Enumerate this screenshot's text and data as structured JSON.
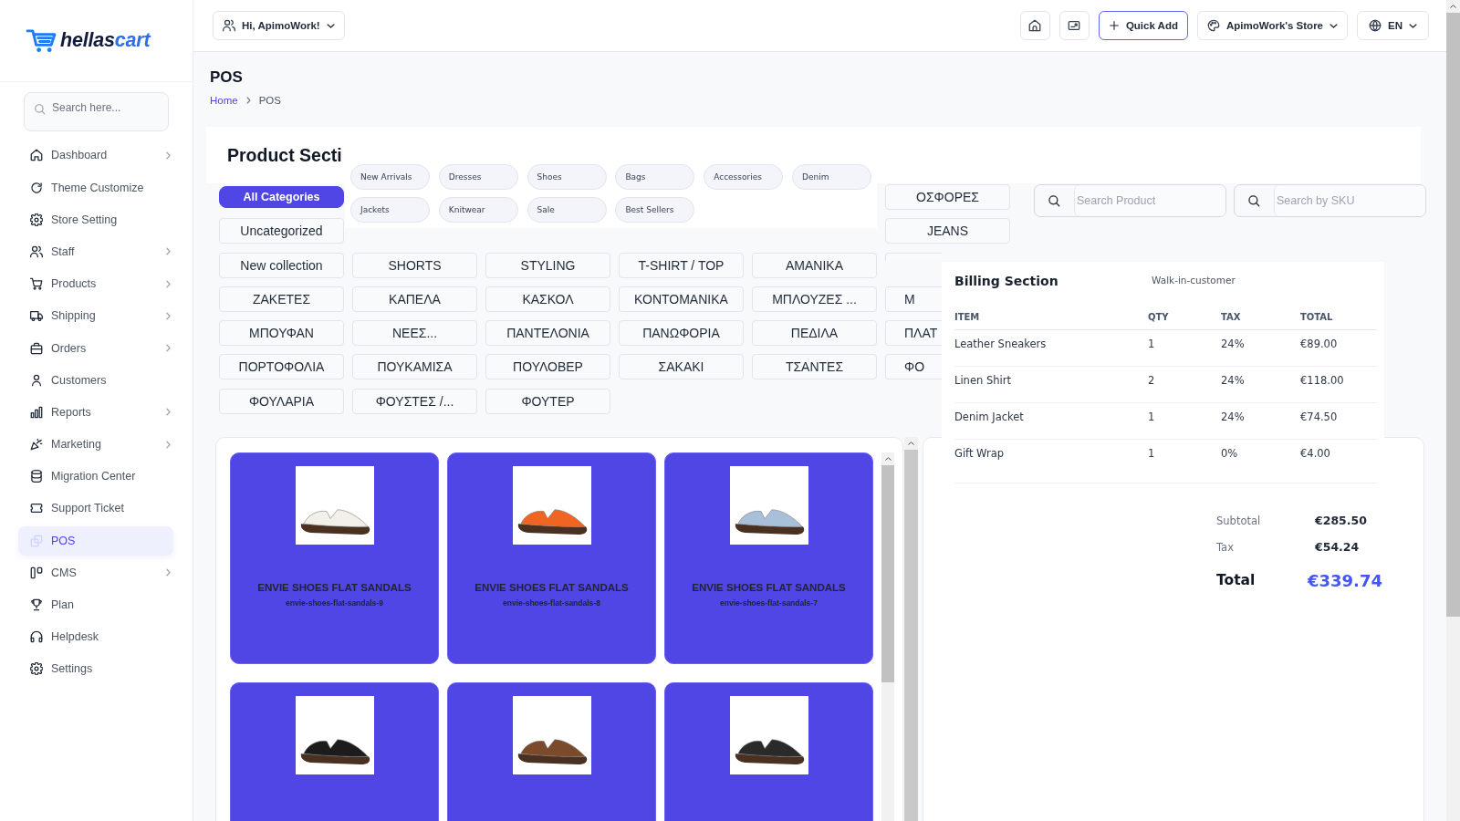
{
  "sidebar": {
    "logo": {
      "brand": "hellas",
      "brand_accent": "cart"
    },
    "search": {
      "placeholder": "Search here..."
    },
    "items": [
      {
        "label": "Dashboard",
        "submenu": true,
        "selected": false
      },
      {
        "label": "Theme Customize",
        "submenu": false,
        "selected": false
      },
      {
        "label": "Store Setting",
        "submenu": false,
        "selected": false
      },
      {
        "label": "Staff",
        "submenu": true,
        "selected": false
      },
      {
        "label": "Products",
        "submenu": true,
        "selected": false
      },
      {
        "label": "Shipping",
        "submenu": true,
        "selected": false
      },
      {
        "label": "Orders",
        "submenu": true,
        "selected": false
      },
      {
        "label": "Customers",
        "submenu": false,
        "selected": false
      },
      {
        "label": "Reports",
        "submenu": true,
        "selected": false
      },
      {
        "label": "Marketing",
        "submenu": true,
        "selected": false
      },
      {
        "label": "Migration Center",
        "submenu": false,
        "selected": false
      },
      {
        "label": "Support Ticket",
        "submenu": false,
        "selected": false
      },
      {
        "label": "POS",
        "submenu": false,
        "selected": true
      },
      {
        "label": "CMS",
        "submenu": true,
        "selected": false
      },
      {
        "label": "Plan",
        "submenu": false,
        "selected": false
      },
      {
        "label": "Helpdesk",
        "submenu": false,
        "selected": false
      },
      {
        "label": "Settings",
        "submenu": false,
        "selected": false
      }
    ]
  },
  "topbar": {
    "greeting": "Hi, ApimoWork!",
    "quick_add": "Quick Add",
    "store": "ApimoWork's Store",
    "language": "EN"
  },
  "page": {
    "title": "POS",
    "breadcrumb": [
      {
        "label": "Home",
        "kind": "link"
      },
      {
        "label": "POS",
        "kind": "current"
      }
    ]
  },
  "product_section": {
    "title": "Product Secti",
    "chips": [
      {
        "label": "New Arrivals",
        "selected": false
      },
      {
        "label": "Dresses",
        "selected": false
      },
      {
        "label": "Shoes",
        "selected": false
      },
      {
        "label": "Bags",
        "selected": false
      },
      {
        "label": "Accessories",
        "selected": false
      },
      {
        "label": "Denim",
        "selected": false
      },
      {
        "label": "Jackets",
        "selected": false
      },
      {
        "label": "Knitwear",
        "selected": false
      },
      {
        "label": "Sale",
        "selected": false
      },
      {
        "label": "Best Sellers",
        "selected": false
      }
    ],
    "categories": [
      {
        "label": "All Categories",
        "selected": true
      },
      {
        "label": "ΟΣΦΟΡΕΣ",
        "selected": false
      },
      {
        "label": "Uncategorized",
        "selected": false
      },
      {
        "label": "JEANS",
        "selected": false
      },
      {
        "label": "New collection",
        "selected": false
      },
      {
        "label": "SHORTS",
        "selected": false
      },
      {
        "label": "STYLING",
        "selected": false
      },
      {
        "label": "T-SHIRT / TOP",
        "selected": false
      },
      {
        "label": "ΑΜΑΝΙΚΑ",
        "selected": false
      },
      {
        "selected": false
      },
      {
        "label": "ΖΑΚΕΤΕΣ",
        "selected": false
      },
      {
        "label": "ΚΑΠΕΛΑ",
        "selected": false
      },
      {
        "label": "ΚΑΣΚΟΛ",
        "selected": false
      },
      {
        "label": "ΚΟΝΤΟΜΑΝΙΚΑ",
        "selected": false
      },
      {
        "label": "ΜΠΛΟΥΖΕΣ ...",
        "selected": false
      },
      {
        "label": "Μ",
        "selected": false
      },
      {
        "label": "ΜΠΟΥΦΑΝ",
        "selected": false
      },
      {
        "label": "ΝΕΕΣ...",
        "selected": false
      },
      {
        "label": "ΠΑΝΤΕΛΟΝΙΑ",
        "selected": false
      },
      {
        "label": "ΠΑΝΩΦΟΡΙΑ",
        "selected": false
      },
      {
        "label": "ΠΕΔΙΛΑ",
        "selected": false
      },
      {
        "label": "ΠΛΑΤ",
        "selected": false
      },
      {
        "label": "ΠΟΡΤΟΦΟΛΙΑ",
        "selected": false
      },
      {
        "label": "ΠΟΥΚΑΜΙΣΑ",
        "selected": false
      },
      {
        "label": "ΠΟΥΛΟΒΕΡ",
        "selected": false
      },
      {
        "label": "ΣΑΚΑΚΙ",
        "selected": false
      },
      {
        "label": "ΤΣΑΝΤΕΣ",
        "selected": false
      },
      {
        "label": "ΦΟ",
        "selected": false
      },
      {
        "label": "ΦΟΥΛΑΡΙΑ",
        "selected": false
      },
      {
        "label": "ΦΟΥΣΤΕΣ /...",
        "selected": false
      },
      {
        "label": "ΦΟΥΤΕΡ",
        "selected": false
      }
    ],
    "search_product": {
      "placeholder": "Search Product"
    },
    "search_sku": {
      "placeholder": "Search by SKU"
    },
    "products": [
      {
        "name": "ENVIE SHOES FLAT SANDALS",
        "slug": "envie-shoes-flat-sandals-9",
        "color": "#f3f0ea"
      },
      {
        "name": "ENVIE SHOES FLAT SANDALS",
        "slug": "envie-shoes-flat-sandals-8",
        "color": "#f06522"
      },
      {
        "name": "ENVIE SHOES FLAT SANDALS",
        "slug": "envie-shoes-flat-sandals-7",
        "color": "#a8c0da"
      },
      {
        "color": "#1c1c1c"
      },
      {
        "color": "#7a4a2a"
      },
      {
        "color": "#2a2a2a"
      }
    ]
  },
  "billing": {
    "title": "Billing Section",
    "customer": "Walk-in-customer",
    "columns": [
      "ITEM",
      "QTY",
      "TAX",
      "TOTAL"
    ],
    "rows": [
      {
        "item": "Leather Sneakers",
        "qty": "1",
        "tax": "24%",
        "total": "€89.00"
      },
      {
        "item": "Linen Shirt",
        "qty": "2",
        "tax": "24%",
        "total": "€118.00"
      },
      {
        "item": "Denim Jacket",
        "qty": "1",
        "tax": "24%",
        "total": "€74.50"
      },
      {
        "item": "Gift Wrap",
        "qty": "1",
        "tax": "0%",
        "total": "€4.00"
      }
    ],
    "summary": [
      {
        "label": "Subtotal",
        "value": "€285.50",
        "kind": "line"
      },
      {
        "label": "Tax",
        "value": "€54.24",
        "kind": "line"
      },
      {
        "label": "Total",
        "value": "€339.74",
        "kind": "grand"
      }
    ]
  }
}
